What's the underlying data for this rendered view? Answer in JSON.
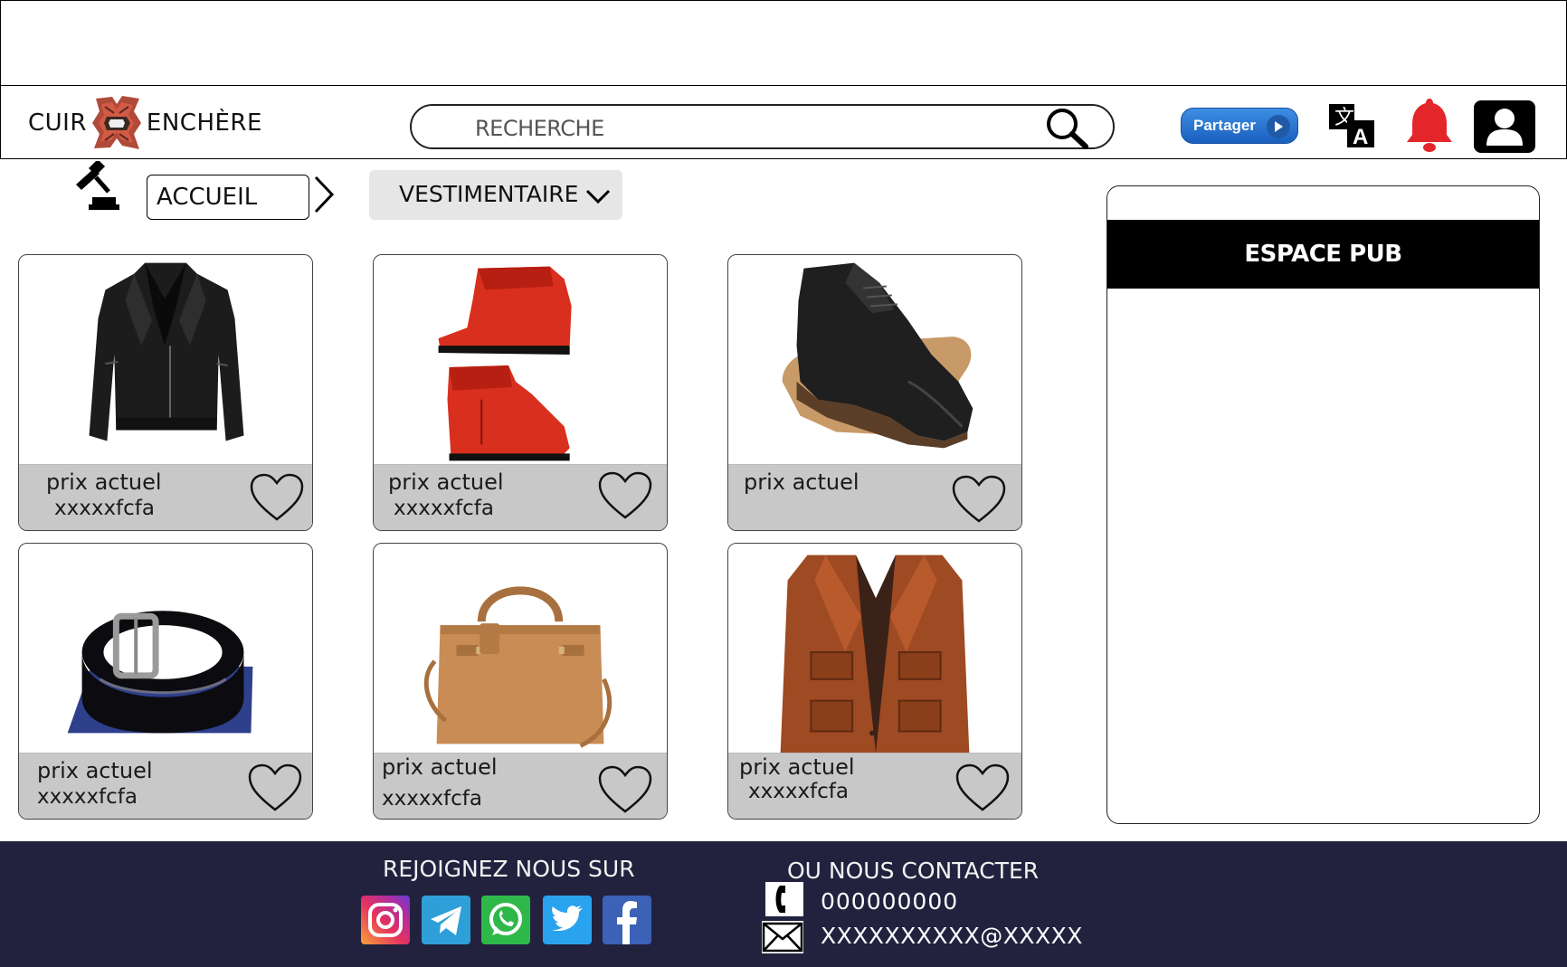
{
  "logo": {
    "left_text": "CUIR",
    "right_text": "ENCHÈRE"
  },
  "search": {
    "placeholder": "RECHERCHE"
  },
  "header": {
    "share_label": "Partager",
    "icons": [
      "translate-icon",
      "bell-icon",
      "user-profile-icon"
    ],
    "colors": {
      "share": "#2874d4",
      "bell": "#e3262a",
      "profile": "#000000"
    }
  },
  "breadcrumb": {
    "home": "ACCUEIL",
    "category": "VESTIMENTAIRE"
  },
  "products": [
    {
      "item": "black leather jacket",
      "label": "prix actuel",
      "price": "xxxxxfcfa"
    },
    {
      "item": "red leather boots",
      "label": "prix actuel",
      "price": "xxxxxfcfa"
    },
    {
      "item": "black leather oxford shoe",
      "label": "prix actuel",
      "price": ""
    },
    {
      "item": "black leather belt",
      "label": "prix actuel",
      "price": "xxxxxfcfa"
    },
    {
      "item": "tan leather handbag",
      "label": "prix actuel",
      "price": "xxxxxfcfa"
    },
    {
      "item": "brown leather jacket",
      "label": "prix actuel",
      "price": "xxxxxfcfa"
    }
  ],
  "ad": {
    "label": "ESPACE PUB"
  },
  "footer": {
    "join_title": "REJOIGNEZ NOUS SUR",
    "contact_title": "OU NOUS CONTACTER",
    "social": [
      "instagram-icon",
      "telegram-icon",
      "whatsapp-icon",
      "twitter-icon",
      "facebook-icon"
    ],
    "phone": "000000000",
    "email": "XXXXXXXXXX@XXXXX",
    "background": "#22223f"
  }
}
